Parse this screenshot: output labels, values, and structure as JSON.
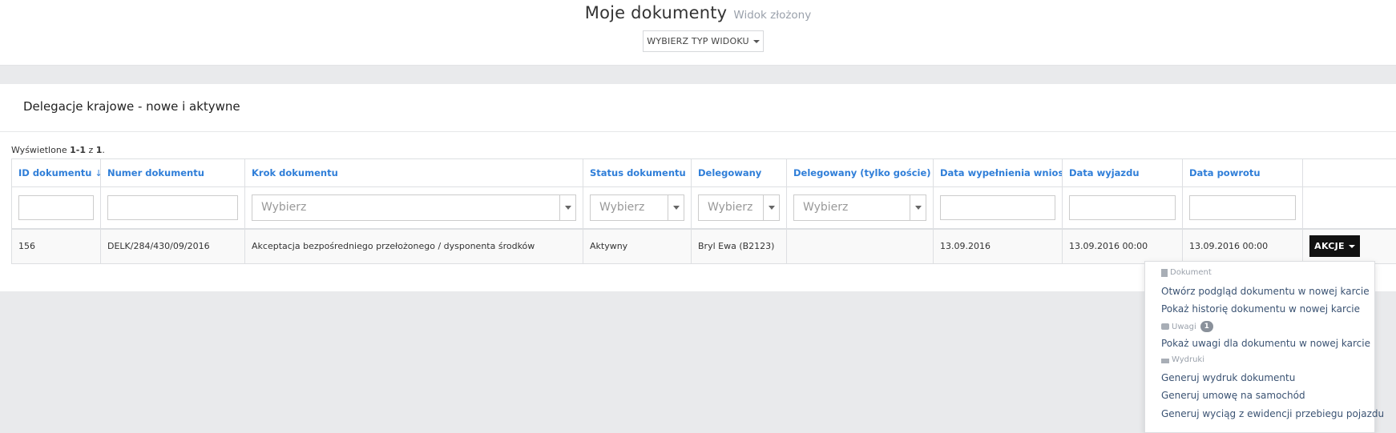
{
  "header": {
    "title": "Moje dokumenty",
    "subtitle": "Widok złożony",
    "view_button_label": "WYBIERZ TYP WIDOKU"
  },
  "panel": {
    "title": "Delegacje krajowe - nowe i aktywne",
    "summary": {
      "prefix": "Wyświetlone ",
      "range": "1-1",
      "middle": " z ",
      "total": "1",
      "suffix": "."
    }
  },
  "table": {
    "columns": [
      "ID dokumentu",
      "Numer dokumentu",
      "Krok dokumentu",
      "Status dokumentu",
      "Delegowany",
      "Delegowany (tylko goście)",
      "Data wypełnienia wniosku",
      "Data wyjazdu",
      "Data powrotu",
      ""
    ],
    "sort_icon": "sort-numeric-asc-icon",
    "filters": {
      "select_placeholder": "Wybierz"
    },
    "rows": [
      {
        "id": "156",
        "number": "DELK/284/430/09/2016",
        "step": "Akceptacja bezpośredniego przełożonego / dysponenta środków",
        "status": "Aktywny",
        "delegate": "Bryl Ewa (B2123)",
        "delegate_guest": "",
        "fill_date": "13.09.2016",
        "departure": "13.09.2016 00:00",
        "return": "13.09.2016 00:00",
        "actions_label": "AKCJE"
      }
    ]
  },
  "actions_menu": {
    "sections": [
      {
        "header": "Dokument",
        "icon": "file-icon",
        "items": [
          "Otwórz podgląd dokumentu w nowej karcie",
          "Pokaż historię dokumentu w nowej karcie"
        ]
      },
      {
        "header": "Uwagi",
        "icon": "comment-icon",
        "badge": "1",
        "items": [
          "Pokaż uwagi dla dokumentu w nowej karcie"
        ]
      },
      {
        "header": "Wydruki",
        "icon": "print-icon",
        "items": [
          "Generuj wydruk dokumentu",
          "Generuj umowę na samochód",
          "Generuj wyciąg z ewidencji przebiegu pojazdu"
        ]
      }
    ]
  },
  "colors": {
    "link_blue": "#2f7ed8",
    "menu_text": "#3b5373",
    "button_dark": "#111111",
    "background": "#e9eaec"
  }
}
